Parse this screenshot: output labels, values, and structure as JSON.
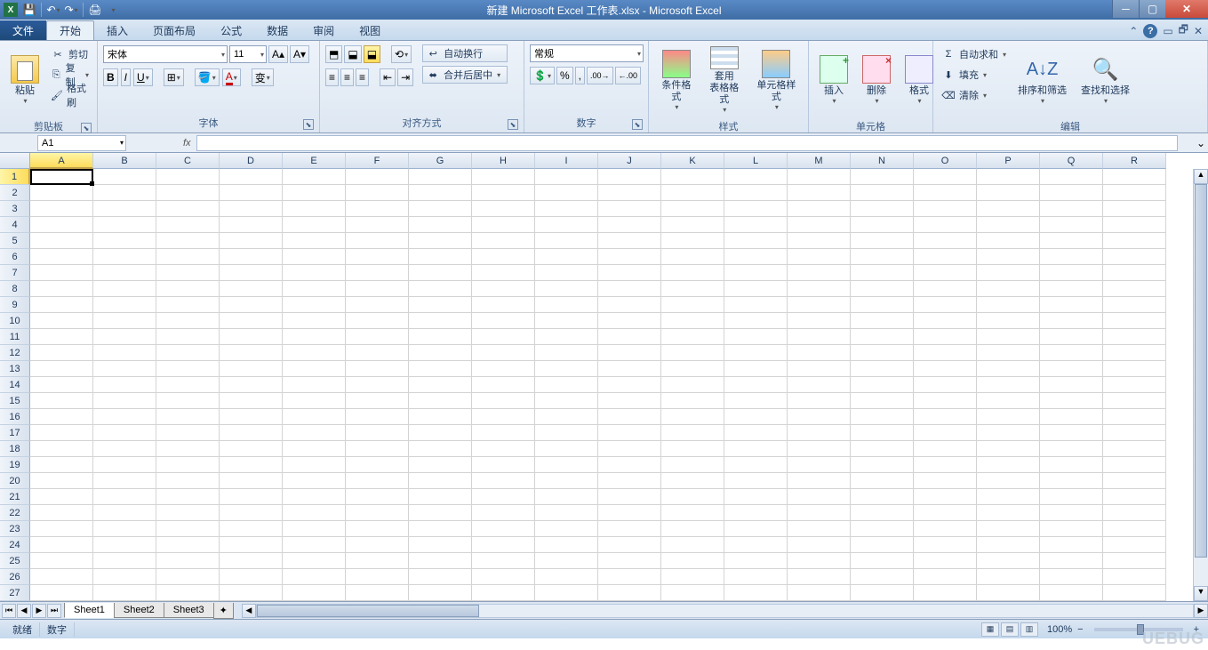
{
  "title": "新建 Microsoft Excel 工作表.xlsx - Microsoft Excel",
  "tabs": {
    "file": "文件",
    "home": "开始",
    "insert": "插入",
    "layout": "页面布局",
    "formula": "公式",
    "data": "数据",
    "review": "审阅",
    "view": "视图"
  },
  "clipboard": {
    "paste": "粘贴",
    "cut": "剪切",
    "copy": "复制",
    "painter": "格式刷",
    "label": "剪贴板"
  },
  "font": {
    "name": "宋体",
    "size": "11",
    "label": "字体"
  },
  "align": {
    "wrap": "自动换行",
    "merge": "合并后居中",
    "label": "对齐方式"
  },
  "number": {
    "format": "常规",
    "label": "数字"
  },
  "styles": {
    "conditional": "条件格式",
    "table": "套用\n表格格式",
    "cell": "单元格样式",
    "label": "样式"
  },
  "cells": {
    "insert": "插入",
    "delete": "删除",
    "format": "格式",
    "label": "单元格"
  },
  "editing": {
    "autosum": "自动求和",
    "fill": "填充",
    "clear": "清除",
    "sort": "排序和筛选",
    "find": "查找和选择",
    "label": "编辑"
  },
  "namebox": "A1",
  "fx": "fx",
  "columns": [
    "A",
    "B",
    "C",
    "D",
    "E",
    "F",
    "G",
    "H",
    "I",
    "J",
    "K",
    "L",
    "M",
    "N",
    "O",
    "P",
    "Q",
    "R"
  ],
  "rows": [
    "1",
    "2",
    "3",
    "4",
    "5",
    "6",
    "7",
    "8",
    "9",
    "10",
    "11",
    "12",
    "13",
    "14",
    "15",
    "16",
    "17",
    "18",
    "19",
    "20",
    "21",
    "22",
    "23",
    "24",
    "25",
    "26",
    "27"
  ],
  "sheets": [
    "Sheet1",
    "Sheet2",
    "Sheet3"
  ],
  "status": {
    "ready": "就绪",
    "mode": "数字",
    "zoom": "100%"
  },
  "watermark": "UEBUG"
}
